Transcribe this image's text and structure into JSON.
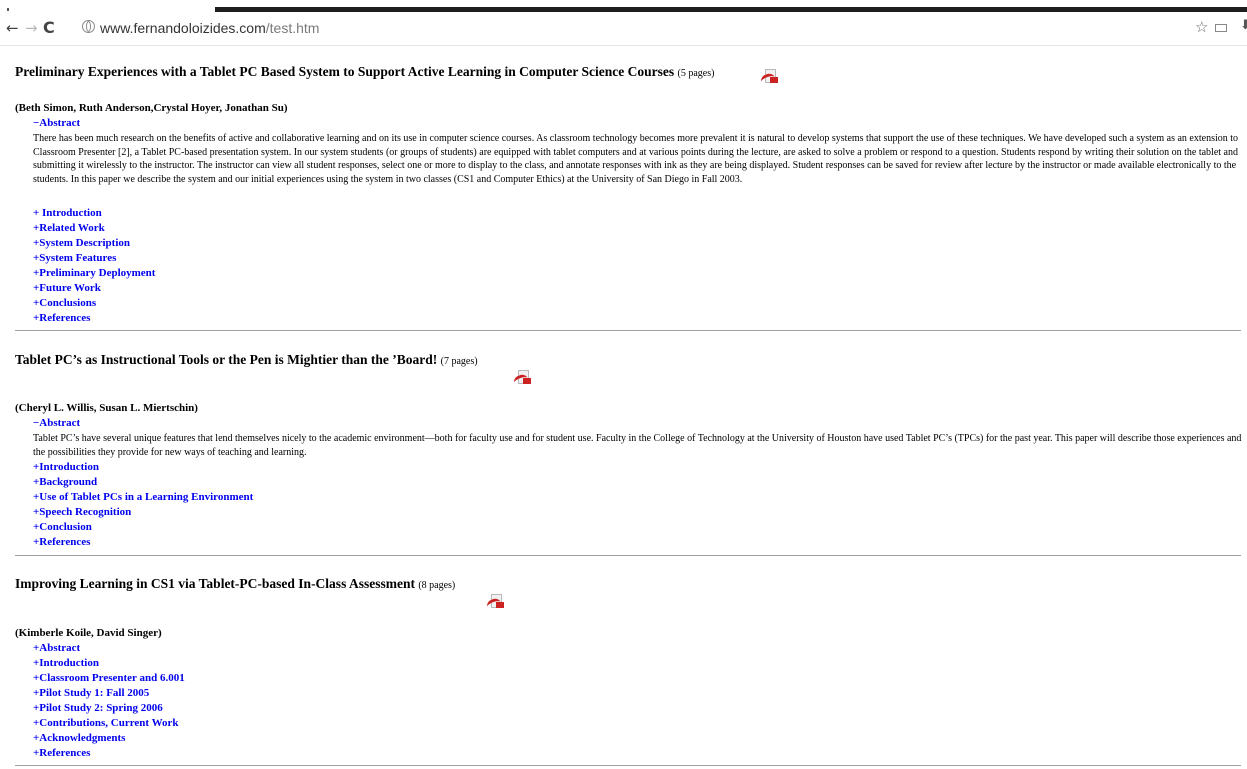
{
  "browser": {
    "back_glyph": "←",
    "forward_glyph": "→",
    "reload_glyph": "C",
    "url_host": "www.fernandoloizides.com",
    "url_path": "/test.htm",
    "star_glyph": "☆",
    "menu_glyph": "⬇"
  },
  "papers": [
    {
      "title": "Preliminary Experiences with a Tablet PC Based System to Support Active Learning in Computer Science Courses",
      "pages": "(5 pages)",
      "authors": "(Beth Simon, Ruth Anderson,Crystal Hoyer, Jonathan Su)",
      "abstract_toggle": "−Abstract",
      "abstract": "There has been much research on the benefits of active and collaborative learning and on its use in computer science courses. As classroom technology becomes more prevalent it is natural to develop systems that support the use of these techniques. We have developed such a system as an extension to Classroom Presenter [2], a Tablet PC-based presentation system. In our system students (or groups of students) are equipped with tablet computers and at various points during the lecture, are asked to solve a problem or respond to a question. Students respond by writing their solution on the tablet and submitting it wirelessly to the instructor. The instructor can view all student responses, select one or more to display to the class, and annotate responses with ink as they are being displayed. Student responses can be saved for review after lecture by the instructor or made available electronically to the students. In this paper we describe the system and our initial experiences using the system in two classes (CS1 and Computer Ethics) at the University of San Diego in Fall 2003.",
      "sections": [
        "+ Introduction",
        "+Related Work",
        "+System Description",
        "+System Features",
        "+Preliminary Deployment",
        "+Future Work",
        "+Conclusions",
        "+References"
      ]
    },
    {
      "title": "Tablet PC’s as Instructional Tools or the Pen is Mightier than the ’Board!",
      "pages": "(7 pages)",
      "authors": "(Cheryl L. Willis, Susan L. Miertschin)",
      "abstract_toggle": "−Abstract",
      "abstract": "Tablet PC’s have several unique features that lend themselves nicely to the academic environment—both for faculty use and for student use. Faculty in the College of Technology at the University of Houston have used Tablet PC’s (TPCs) for the past year. This paper will describe those experiences and the possibilities they provide for new ways of teaching and learning.",
      "sections": [
        "+Introduction",
        "+Background",
        "+Use of Tablet PCs in a Learning Environment",
        "+Speech Recognition",
        "+Conclusion",
        "+References"
      ]
    },
    {
      "title": "Improving Learning in CS1 via Tablet-PC-based In-Class Assessment",
      "pages": "(8 pages)",
      "authors": "(Kimberle Koile, David Singer)",
      "sections": [
        "+Abstract",
        "+Introduction",
        "+Classroom Presenter and 6.001",
        "+Pilot Study 1: Fall 2005",
        "+Pilot Study 2: Spring 2006",
        "+Contributions, Current Work",
        "+Acknowledgments",
        "+References"
      ]
    }
  ],
  "colors": {
    "link": "#0000ee",
    "rule": "#a0a0a0",
    "pdf_red": "#cc2222"
  }
}
